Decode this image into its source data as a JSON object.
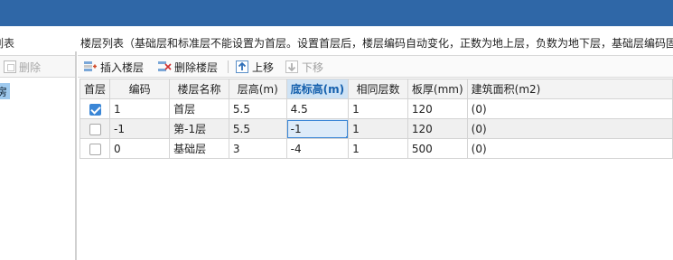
{
  "left_panel": {
    "header": "列表",
    "delete_label": "删除",
    "selected_item": "房"
  },
  "right_panel": {
    "caption": "楼层列表（基础层和标准层不能设置为首层。设置首层后，楼层编码自动变化，正数为地上层，负数为地下层，基础层编码固定",
    "toolbar": {
      "insert_label": "插入楼层",
      "delete_label": "删除楼层",
      "up_label": "上移",
      "down_label": "下移",
      "insert_icon": "insert-floor-icon",
      "delete_icon": "delete-floor-icon",
      "up_icon": "arrow-up-icon",
      "down_icon": "arrow-down-icon"
    },
    "columns": [
      "首层",
      "编码",
      "楼层名称",
      "层高(m)",
      "底标高(m)",
      "相同层数",
      "板厚(mm)",
      "建筑面积(m2)"
    ],
    "active_column": "底标高(m)",
    "rows": [
      {
        "first": true,
        "code": "1",
        "name": "首层",
        "height": "5.5",
        "bottom": "4.5",
        "same": "1",
        "slab": "120",
        "area": "(0)"
      },
      {
        "first": false,
        "code": "-1",
        "name": "第-1层",
        "height": "5.5",
        "bottom": "-1",
        "same": "1",
        "slab": "120",
        "area": "(0)"
      },
      {
        "first": false,
        "code": "0",
        "name": "基础层",
        "height": "3",
        "bottom": "-4",
        "same": "1",
        "slab": "500",
        "area": "(0)"
      }
    ]
  },
  "colors": {
    "titlebar": "#2f67a7",
    "accent": "#3a86d6",
    "selection": "#9ec9ee"
  }
}
